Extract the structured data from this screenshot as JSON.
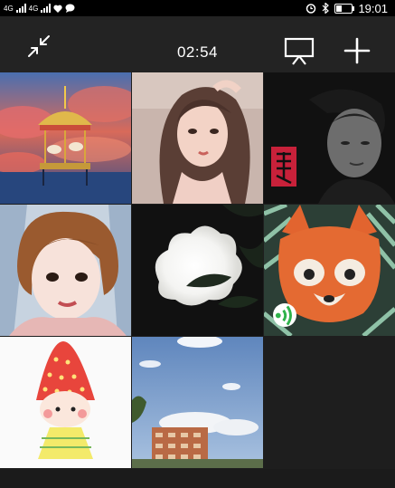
{
  "status_bar": {
    "carrier_left": "4G",
    "carrier_right": "4G",
    "time": "19:01"
  },
  "toolbar": {
    "timer": "02:54",
    "collapse_icon": "collapse-icon",
    "cast_icon": "screen-cast-icon",
    "add_icon": "plus-icon"
  },
  "grid": {
    "tiles": [
      {
        "name": "tile-carousel",
        "subject": "carousel illustration"
      },
      {
        "name": "tile-woman-portrait",
        "subject": "anime-style woman"
      },
      {
        "name": "tile-man-portrait",
        "subject": "man in shadow with red seal"
      },
      {
        "name": "tile-cartoon-woman",
        "subject": "cartoon woman short hair"
      },
      {
        "name": "tile-cloud-lamp",
        "subject": "glowing cloud lamp"
      },
      {
        "name": "tile-fox",
        "subject": "fox illustration",
        "badge": "voice-icon"
      },
      {
        "name": "tile-strawberry-girl",
        "subject": "strawberry hat girl"
      },
      {
        "name": "tile-sky-building",
        "subject": "sky over building"
      }
    ]
  },
  "colors": {
    "background": "#1e1e1e",
    "toolbar": "#232323",
    "badge_green": "#2fb24b"
  }
}
